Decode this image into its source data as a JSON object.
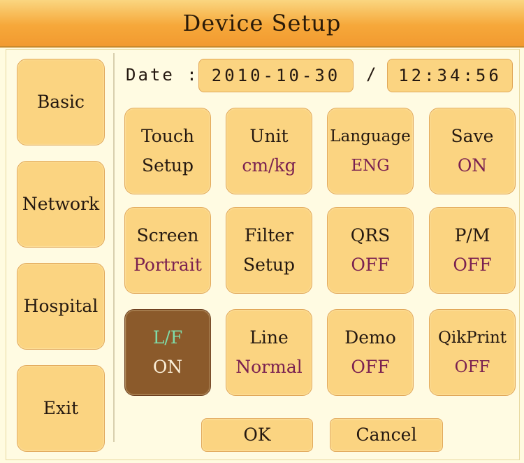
{
  "window": {
    "title": "Device Setup"
  },
  "sidebar": {
    "items": [
      {
        "label": "Basic"
      },
      {
        "label": "Network"
      },
      {
        "label": "Hospital"
      },
      {
        "label": "Exit"
      }
    ]
  },
  "datetime": {
    "label": "Date :",
    "date": "2010-10-30",
    "separator": "/",
    "time": "12:34:56"
  },
  "grid": [
    {
      "label": "Touch",
      "value": "Setup"
    },
    {
      "label": "Unit",
      "value": "cm/kg"
    },
    {
      "label": "Language",
      "value": "ENG"
    },
    {
      "label": "Save",
      "value": "ON"
    },
    {
      "label": "Screen",
      "value": "Portrait"
    },
    {
      "label": "Filter",
      "value": "Setup"
    },
    {
      "label": "QRS",
      "value": "OFF"
    },
    {
      "label": "P/M",
      "value": "OFF"
    },
    {
      "label": "L/F",
      "value": "ON",
      "selected": true
    },
    {
      "label": "Line",
      "value": "Normal"
    },
    {
      "label": "Demo",
      "value": "OFF"
    },
    {
      "label": "QikPrint",
      "value": "OFF"
    }
  ],
  "footer": {
    "ok_label": "OK",
    "cancel_label": "Cancel"
  },
  "colors": {
    "button_fill": "#fbd481",
    "selected_fill": "#8b5a2b",
    "value_text": "#7a2050",
    "selected_label_text": "#7fdca9",
    "title_bar": "#f6a83a"
  }
}
